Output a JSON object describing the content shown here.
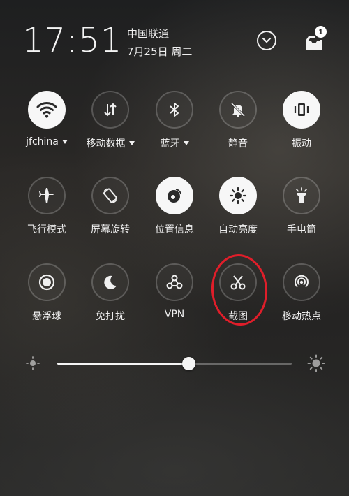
{
  "status": {
    "time": "17:51",
    "carrier": "中国联通",
    "date": "7月25日 周二",
    "notification_count": "1"
  },
  "toggles": [
    {
      "label": "jfchina",
      "icon": "wifi-icon",
      "on": true,
      "dropdown": true
    },
    {
      "label": "移动数据",
      "icon": "mobile-data-icon",
      "on": false,
      "dropdown": true
    },
    {
      "label": "蓝牙",
      "icon": "bluetooth-icon",
      "on": false,
      "dropdown": true
    },
    {
      "label": "静音",
      "icon": "mute-bell-icon",
      "on": false,
      "dropdown": false
    },
    {
      "label": "振动",
      "icon": "vibrate-icon",
      "on": true,
      "dropdown": false
    },
    {
      "label": "飞行模式",
      "icon": "airplane-icon",
      "on": false,
      "dropdown": false
    },
    {
      "label": "屏幕旋转",
      "icon": "rotate-screen-icon",
      "on": false,
      "dropdown": false
    },
    {
      "label": "位置信息",
      "icon": "location-icon",
      "on": true,
      "dropdown": false
    },
    {
      "label": "自动亮度",
      "icon": "auto-brightness-icon",
      "on": true,
      "dropdown": false
    },
    {
      "label": "手电筒",
      "icon": "flashlight-icon",
      "on": false,
      "dropdown": false
    },
    {
      "label": "悬浮球",
      "icon": "floating-ball-icon",
      "on": false,
      "dropdown": false
    },
    {
      "label": "免打扰",
      "icon": "moon-icon",
      "on": false,
      "dropdown": false
    },
    {
      "label": "VPN",
      "icon": "vpn-icon",
      "on": false,
      "dropdown": false
    },
    {
      "label": "截图",
      "icon": "scissors-icon",
      "on": false,
      "dropdown": false
    },
    {
      "label": "移动热点",
      "icon": "hotspot-icon",
      "on": false,
      "dropdown": false
    }
  ],
  "brightness": {
    "level": 0.56,
    "low_icon": "brightness-low-icon",
    "high_icon": "brightness-high-icon"
  },
  "colors": {
    "annotation": "#e01e2a",
    "toggle_on_bg": "#f7f7f7",
    "text": "#f0f0f0"
  }
}
